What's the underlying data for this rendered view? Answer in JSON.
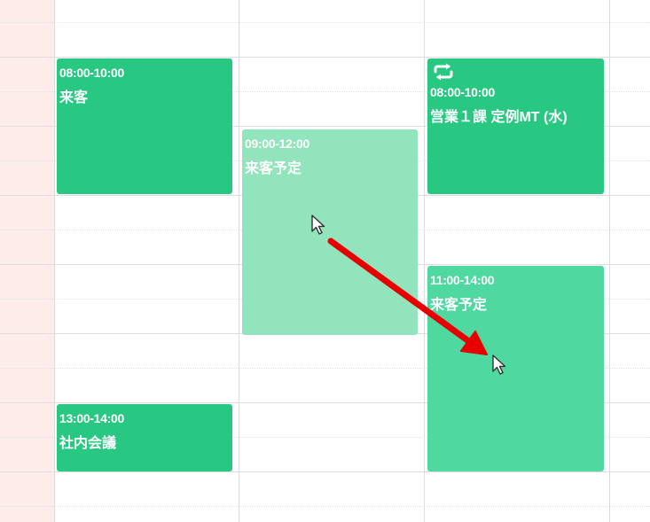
{
  "colors": {
    "event_solid": "#28c883",
    "event_dragging_source": "#91e4bc",
    "event_drop_preview": "#4fd89f",
    "time_gutter": "#fdece9",
    "drag_arrow": "#e60000"
  },
  "events": [
    {
      "time": "08:00-10:00",
      "title": "来客",
      "recurring": false
    },
    {
      "time": "09:00-12:00",
      "title": "来客予定",
      "recurring": false,
      "state": "drag-source"
    },
    {
      "time": "08:00-10:00",
      "title": "営業１課 定例MT (水)",
      "recurring": true,
      "icon": "repeat-icon"
    },
    {
      "time": "11:00-14:00",
      "title": "来客予定",
      "recurring": false,
      "state": "drop-preview"
    },
    {
      "time": "13:00-14:00",
      "title": "社内会議",
      "recurring": false
    }
  ],
  "annotation": {
    "type": "drag-arrow",
    "from": "event 09:00-12:00 (来客予定)",
    "to": "event 11:00-14:00 (来客予定)",
    "cursor_icons": [
      "mouse-pointer-icon",
      "mouse-pointer-icon"
    ]
  }
}
